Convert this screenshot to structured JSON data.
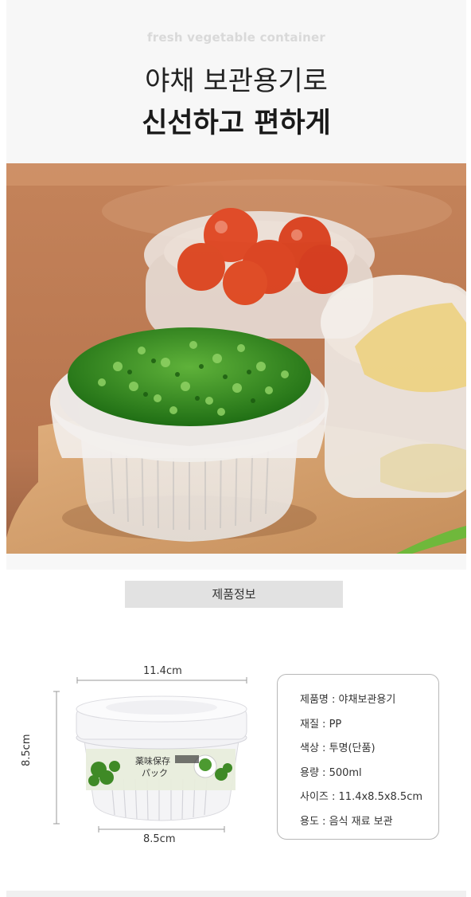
{
  "header": {
    "eyebrow": "fresh vegetable container",
    "title_line1": "야채 보관용기로",
    "title_line2": "신선하고 편하게"
  },
  "section": {
    "label": "제품정보"
  },
  "dimensions": {
    "width_top": "11.4cm",
    "width_bottom": "8.5cm",
    "height": "8.5cm"
  },
  "package_label": {
    "line1": "薬味保存",
    "line2": "パック"
  },
  "specs": [
    "제품명 : 야채보관용기",
    "재질 : PP",
    "색상 : 투명(단품)",
    "용량 : 500ml",
    "사이즈 : 11.4x8.5x8.5cm",
    "용도 : 음식 재료 보관"
  ],
  "colors": {
    "background": "#f7f7f7",
    "section_label_bg": "#e2e2e2",
    "wood": "#c98f5d",
    "scallion": "#2f8a1f",
    "tomato": "#e23a1c"
  }
}
